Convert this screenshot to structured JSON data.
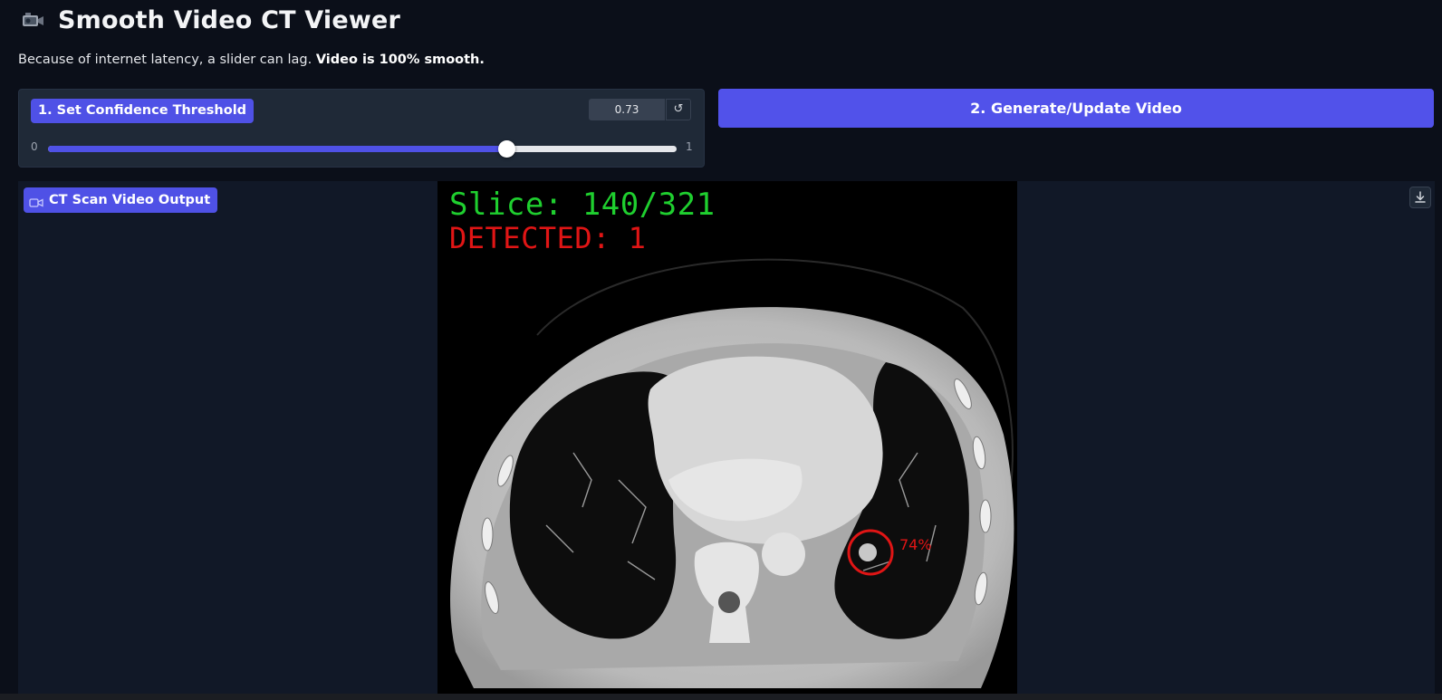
{
  "header": {
    "title": "Smooth Video CT Viewer",
    "icon": "video-camera-icon"
  },
  "subtitle": {
    "text": "Because of internet latency, a slider can lag. ",
    "bold": "Video is 100% smooth."
  },
  "slider": {
    "label": "1. Set Confidence Threshold",
    "value": "0.73",
    "min": "0",
    "max": "1",
    "fraction": 0.73,
    "reset_icon": "↺"
  },
  "generate_button": {
    "label": "2. Generate/Update Video"
  },
  "video": {
    "label": "CT Scan Video Output",
    "slice_text": "Slice: 140/321",
    "detected_text": "DETECTED: 1",
    "detection_label": "74%",
    "download_icon": "download-icon"
  },
  "colors": {
    "accent": "#4f51e6",
    "background": "#0b0f19",
    "panel": "#1f2937",
    "slice_green": "#1fcf2f",
    "detected_red": "#e01515"
  }
}
